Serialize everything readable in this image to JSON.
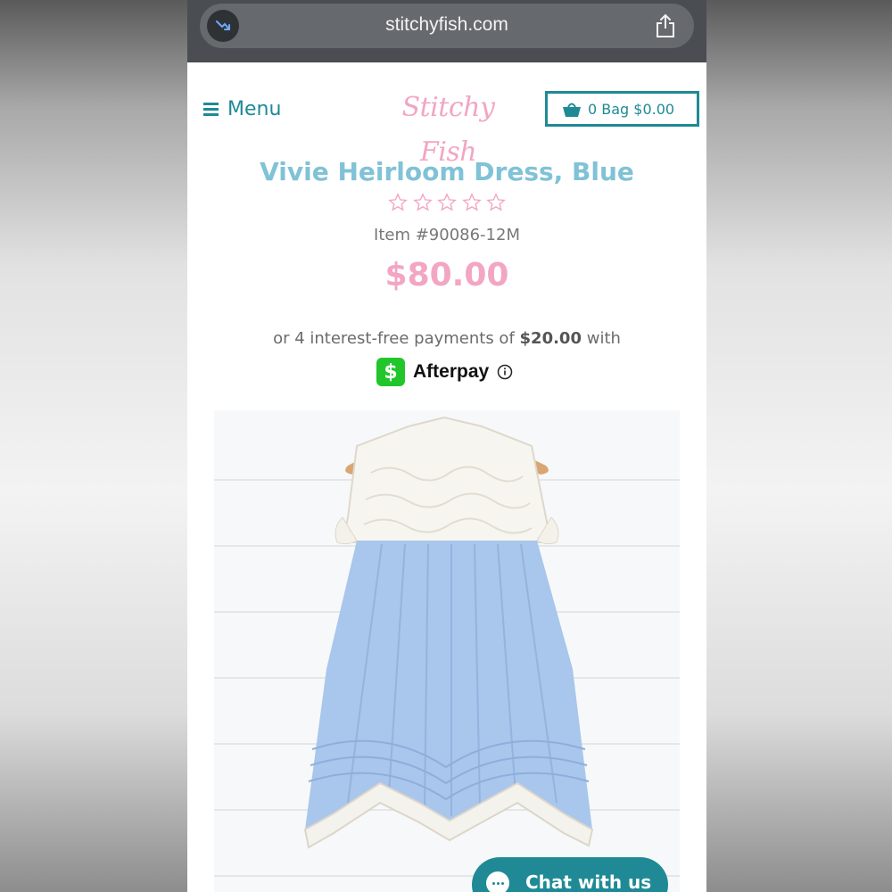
{
  "browser": {
    "url": "stitchyfish.com",
    "tracker_icon": "trending-down-icon",
    "share_icon": "share-icon"
  },
  "header": {
    "menu_label": "Menu",
    "logo_text": "Stitchy Fish",
    "bag_label": "0 Bag $0.00",
    "bag_icon": "shopping-basket-icon"
  },
  "product": {
    "title": "Vivie Heirloom Dress, Blue",
    "rating": 0,
    "max_rating": 5,
    "item_number": "Item #90086-12M",
    "price": "$80.00"
  },
  "afterpay": {
    "prefix": "or 4 interest-free payments of",
    "amount": "$20.00",
    "suffix": "with",
    "brand": "Afterpay",
    "badge_glyph": "$"
  },
  "chat": {
    "label": "Chat with us"
  },
  "colors": {
    "brand_teal": "#1f8a95",
    "title_blue": "#80c2d6",
    "price_pink": "#f2a6c3",
    "afterpay_green": "#22c62c"
  }
}
